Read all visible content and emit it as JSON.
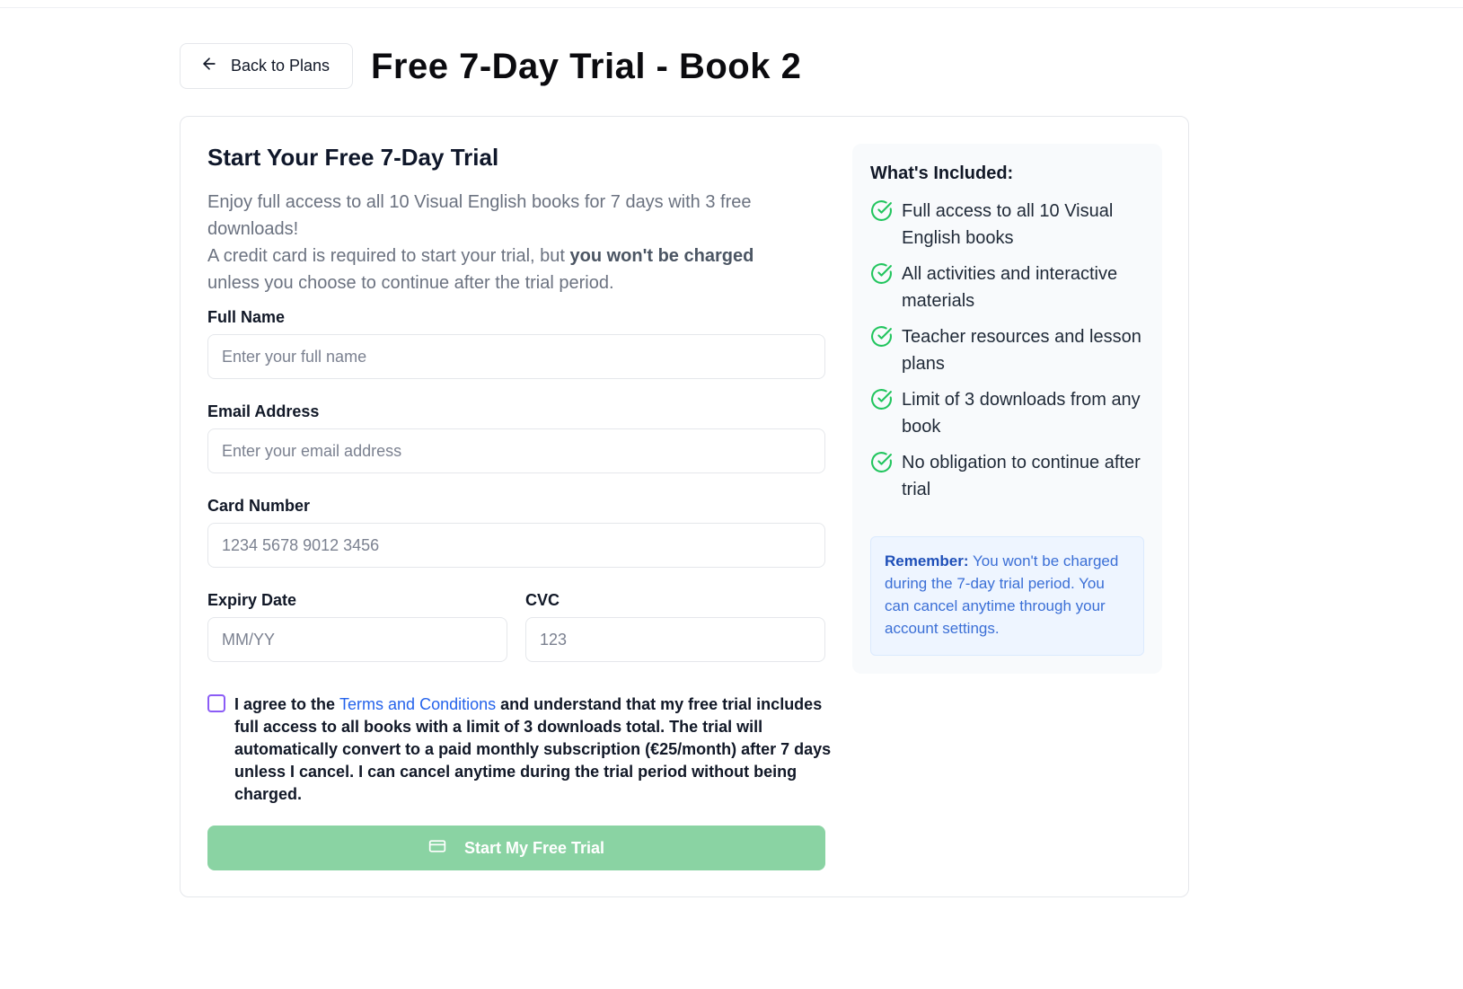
{
  "header": {
    "back_label": "Back to Plans",
    "title": "Free 7-Day Trial - Book 2"
  },
  "form": {
    "title": "Start Your Free 7-Day Trial",
    "intro_line1": "Enjoy full access to all 10 Visual English books for 7 days with 3 free downloads!",
    "intro_line2_pre": "A credit card is required to start your trial, but ",
    "intro_line2_bold": "you won't be charged",
    "intro_line2_post": " unless you choose to continue after the trial period.",
    "full_name": {
      "label": "Full Name",
      "placeholder": "Enter your full name",
      "value": ""
    },
    "email": {
      "label": "Email Address",
      "placeholder": "Enter your email address",
      "value": ""
    },
    "card_number": {
      "label": "Card Number",
      "placeholder": "1234 5678 9012 3456",
      "value": ""
    },
    "expiry": {
      "label": "Expiry Date",
      "placeholder": "MM/YY",
      "value": ""
    },
    "cvc": {
      "label": "CVC",
      "placeholder": "123",
      "value": ""
    },
    "agree_pre": "I agree to the ",
    "agree_link": "Terms and Conditions",
    "agree_post": " and understand that my free trial includes full access to all books with a limit of 3 downloads total. The trial will automatically convert to a paid monthly subscription (€25/month) after 7 days unless I cancel. I can cancel anytime during the trial period without being charged.",
    "agree_checked": false,
    "submit_label": "Start My Free Trial"
  },
  "included": {
    "title": "What's Included:",
    "items": [
      "Full access to all 10 Visual English books",
      "All activities and interactive materials",
      "Teacher resources and lesson plans",
      "Limit of 3 downloads from any book",
      "No obligation to continue after trial"
    ],
    "remember_label": "Remember:",
    "remember_text": " You won't be charged during the 7-day trial period. You can cancel anytime through your account settings."
  },
  "colors": {
    "accent_green": "#22c55e",
    "submit_disabled": "#8ad3a3",
    "link_blue": "#2563eb",
    "checkbox_purple": "#8b5cf6"
  }
}
